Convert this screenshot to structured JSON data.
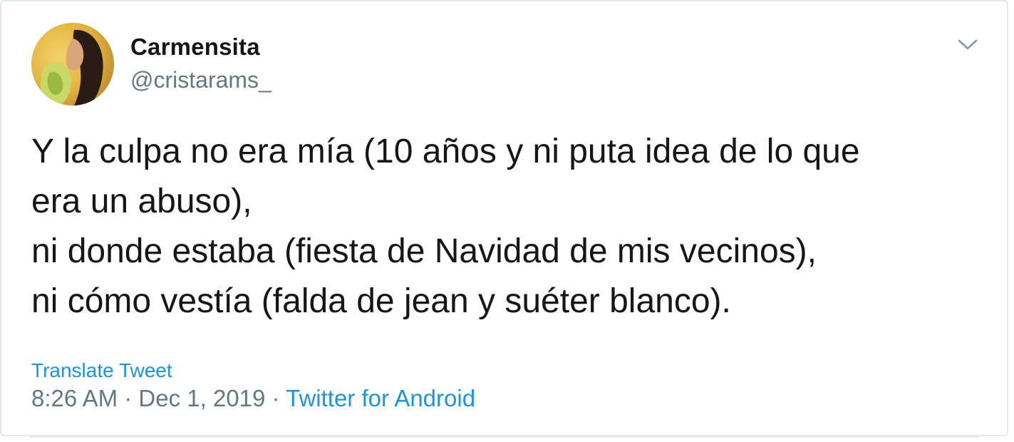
{
  "tweet": {
    "display_name": "Carmensita",
    "handle": "@cristarams_",
    "text_lines": [
      "Y la culpa no era mía (10 años y ni puta idea de lo que",
      "era un abuso),",
      "ni donde estaba (fiesta de Navidad de mis vecinos),",
      "ni cómo vestía (falda de jean y suéter blanco)."
    ],
    "translate_label": "Translate Tweet",
    "time": "8:26 AM",
    "separator": " · ",
    "date": "Dec 1, 2019",
    "source": "Twitter for Android"
  },
  "icons": {
    "menu": "chevron-down-icon"
  },
  "colors": {
    "link": "#1b95e0",
    "secondary_text": "#657786",
    "primary_text": "#14171a"
  }
}
